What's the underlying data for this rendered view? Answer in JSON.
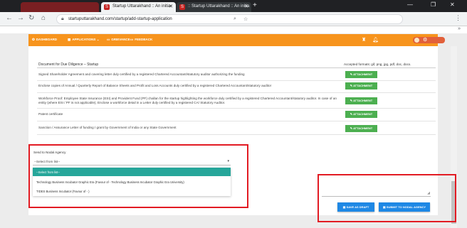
{
  "browser": {
    "tabs": [
      {
        "title": "Startup Uttarakhand :: An initia",
        "active": true
      },
      {
        "title": ":: Startup Uttarakhand :: An initia",
        "active": false
      }
    ],
    "url": "startuputtarakhand.com/startup/add-startup-application"
  },
  "appnav": {
    "items": [
      {
        "label": "DASHBOARD",
        "icon": "dashboard-icon"
      },
      {
        "label": "APPLICATIONS",
        "icon": "applications-icon"
      },
      {
        "label": "GRIEVANCE",
        "icon": "grievance-icon"
      },
      {
        "label": "FEEDBACK",
        "icon": "feedback-icon"
      }
    ]
  },
  "documents": {
    "header": "Document for Due Diligence – Startup",
    "formats_label": "Accepted formats: gif, png, jpg, pdf, doc, docx.",
    "attachment_label": "ATTACHMENT",
    "rows": [
      "Signed Shareholder Agreement and covering letter duly certified by a registered Chartered Accountant/statutory auditor authorizing the funding",
      "Enclose copies of Annual / Quarterly Report of Balance Sheets and Profit and Loss Accounts duly certified by a registered Chartered Accountant/statutory auditor",
      "Workforce Proof: Employee State Insurance (ESI) and Provident Fund (PF) challan for the startup highlighting the workforce duly certified by a registered Chartered Accountant/statutory auditor. In case of an entity (where ESI / PF is not applicable), Enclose a workforce detail in a Letter duly certified by a registered CA/ Statutory Auditor.",
      "Patent certificate",
      "Sanction / Assurance Letter of funding / grant by Government of India or any State Government"
    ]
  },
  "agency": {
    "label": "Send to Nodal Agency",
    "selected": "--Select from list--",
    "options": [
      "--Select from list--",
      "Technology Business Incubator Graphic Era (Favour of - Technology Business Incubator Graphic Era University)",
      "TIDES Business Incubator (Favour of - )"
    ]
  },
  "actions": {
    "save_draft": "SAVE AS DRAFT",
    "submit": "SUBMIT TO NODAL AGENCY"
  },
  "colors": {
    "header_orange": "#f7941d",
    "attachment_green": "#4caf50",
    "selected_option_teal": "#26a69a",
    "action_blue": "#1e88e5",
    "highlight_red": "#e21b23"
  }
}
